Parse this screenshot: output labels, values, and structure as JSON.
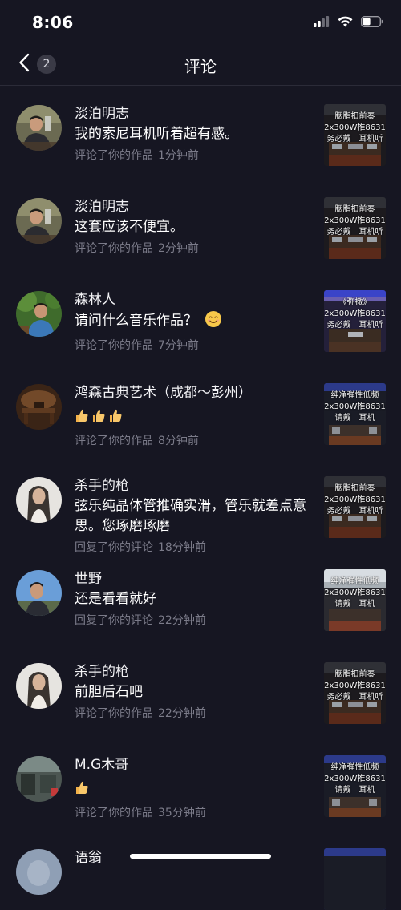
{
  "status_bar": {
    "time": "8:06"
  },
  "header": {
    "title": "评论",
    "badge_count": "2"
  },
  "comments": [
    {
      "username": "淡泊明志",
      "text": "我的索尼耳机听着超有感。",
      "action": "评论了你的作品",
      "time": "1分钟前",
      "thumb_caption": "胭脂扣前奏\n2x300W推8631\n务必戴　耳机听"
    },
    {
      "username": "淡泊明志",
      "text": "这套应该不便宜。",
      "action": "评论了你的作品",
      "time": "2分钟前",
      "thumb_caption": "胭脂扣前奏\n2x300W推8631\n务必戴　耳机听"
    },
    {
      "username": "森林人",
      "text": "请问什么音乐作品？",
      "action": "评论了你的作品",
      "time": "7分钟前",
      "thumb_caption": "《弥撒》\n2x300W推8631\n务必戴　耳机听"
    },
    {
      "username": "鸿森古典艺术（成都～彭州）",
      "text": "",
      "action": "评论了你的作品",
      "time": "8分钟前",
      "thumb_caption": "纯净弹性低频\n2x300W推8631\n请戴　耳机"
    },
    {
      "username": "杀手的枪",
      "text": "弦乐纯晶体管推确实滑，管乐就差点意思。您琢磨琢磨",
      "action": "回复了你的评论",
      "time": "18分钟前",
      "thumb_caption": "胭脂扣前奏\n2x300W推8631\n务必戴　耳机听"
    },
    {
      "username": "世野",
      "text": "还是看看就好",
      "action": "回复了你的评论",
      "time": "22分钟前",
      "thumb_caption": "纯净弹性低频\n2x300W推8631\n请戴　耳机"
    },
    {
      "username": "杀手的枪",
      "text": "前胆后石吧",
      "action": "评论了你的作品",
      "time": "22分钟前",
      "thumb_caption": "胭脂扣前奏\n2x300W推8631\n务必戴　耳机听"
    },
    {
      "username": "M.G木哥",
      "text": "",
      "action": "评论了你的作品",
      "time": "35分钟前",
      "thumb_caption": "纯净弹性低频\n2x300W推8631\n请戴　耳机"
    },
    {
      "username": "语翁",
      "text": "",
      "action": "",
      "time": "",
      "thumb_caption": ""
    }
  ],
  "colors": {
    "background": "#161622",
    "secondary_text": "#7b7b89"
  }
}
